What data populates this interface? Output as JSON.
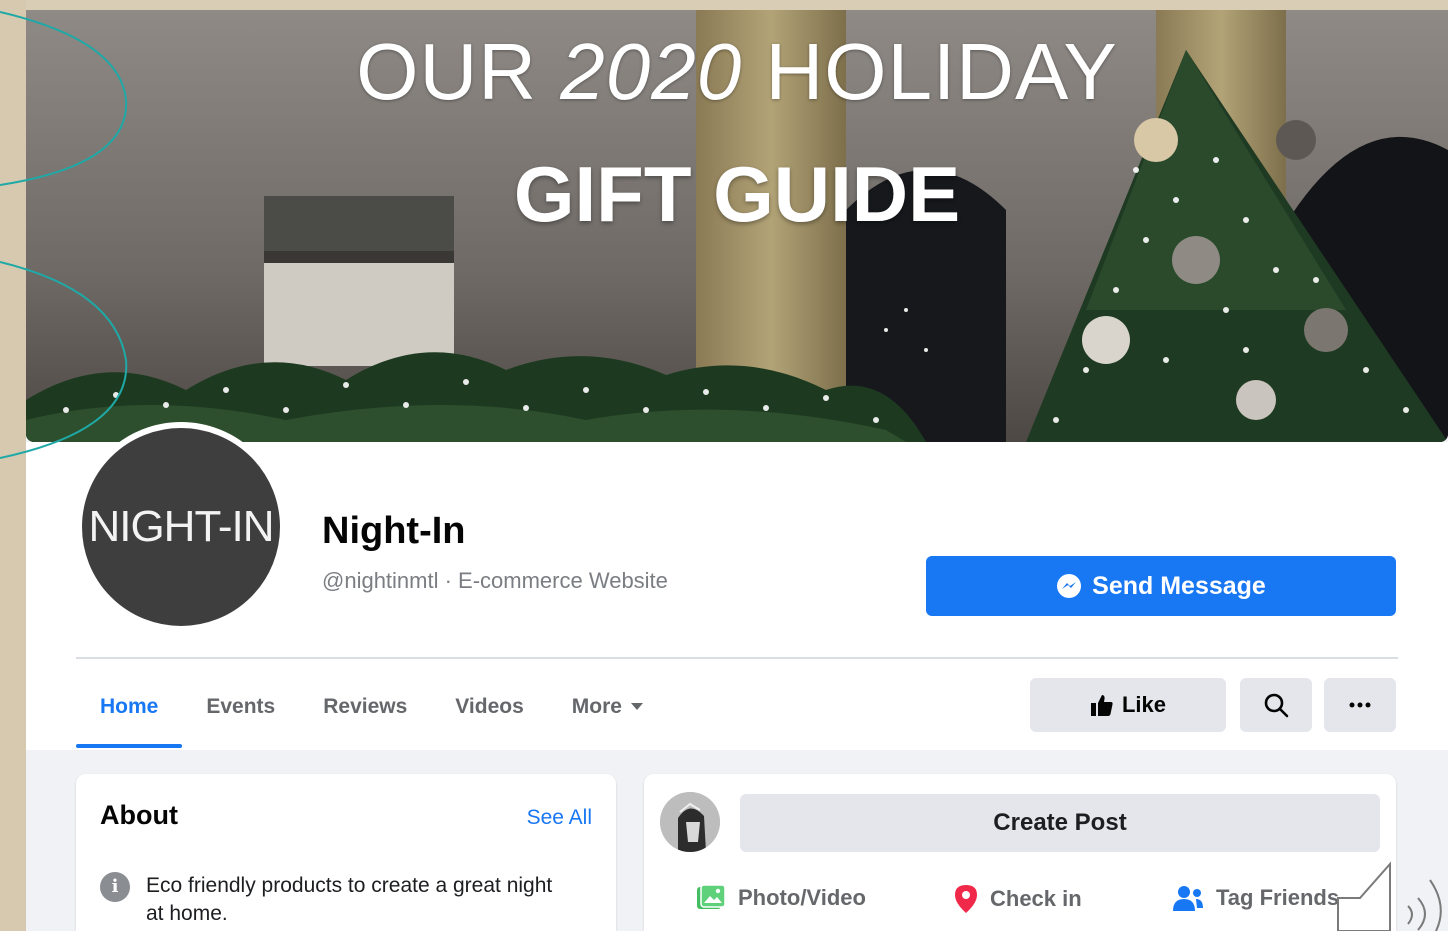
{
  "cover": {
    "line1_prefix": "OUR ",
    "line1_year": "2020",
    "line1_suffix": " HOLIDAY",
    "line2": "GIFT GUIDE"
  },
  "profile": {
    "avatar_text": "NIGHT-IN",
    "name": "Night-In",
    "subtitle": "@nightinmtl · E-commerce Website"
  },
  "actions": {
    "send_message": "Send Message",
    "like": "Like"
  },
  "tabs": [
    {
      "label": "Home",
      "active": true
    },
    {
      "label": "Events"
    },
    {
      "label": "Reviews"
    },
    {
      "label": "Videos"
    },
    {
      "label": "More"
    }
  ],
  "about": {
    "title": "About",
    "see_all": "See All",
    "description": "Eco friendly products to create a great night at home."
  },
  "composer": {
    "create_post": "Create Post",
    "photo_video": "Photo/Video",
    "check_in": "Check in",
    "tag_friends": "Tag Friends"
  },
  "colors": {
    "brand_blue": "#1877f2",
    "button_gray": "#e4e6eb",
    "accent_teal": "#1fa9a6"
  },
  "icons": [
    "messenger-icon",
    "thumbs-up-icon",
    "search-icon",
    "more-icon",
    "info-icon",
    "photo-icon",
    "location-pin-icon",
    "tag-people-icon",
    "speaker-icon"
  ]
}
